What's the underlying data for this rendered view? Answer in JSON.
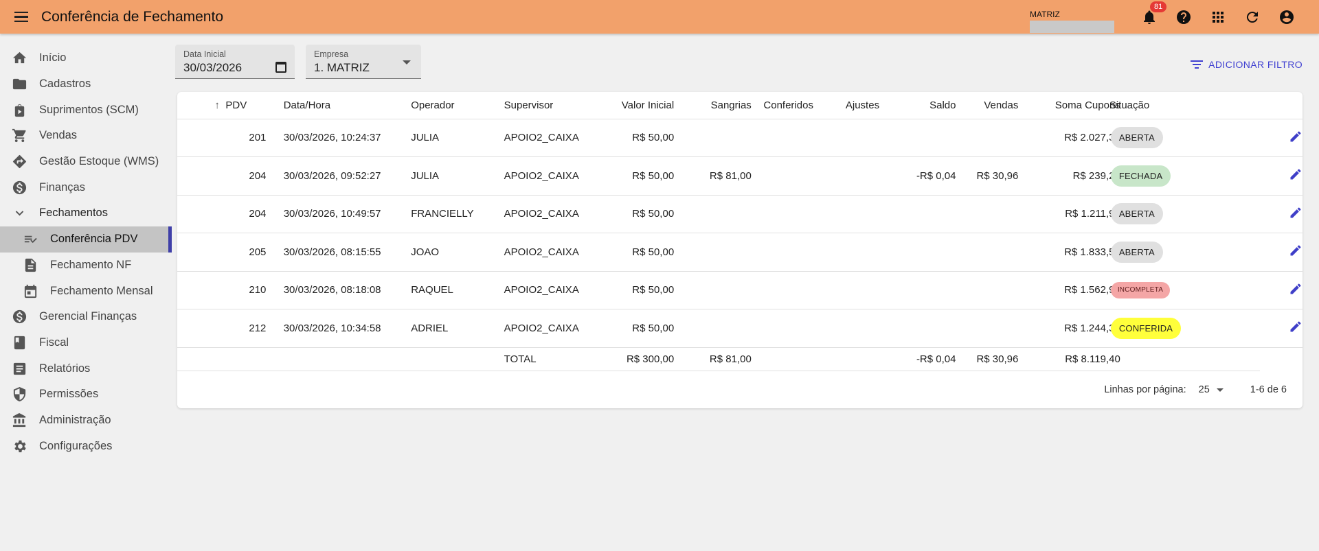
{
  "header": {
    "title": "Conferência de Fechamento",
    "company_label": "MATRIZ",
    "notification_count": "81"
  },
  "sidebar": {
    "items": [
      {
        "label": "Início",
        "icon": "home-icon"
      },
      {
        "label": "Cadastros",
        "icon": "folder-icon"
      },
      {
        "label": "Suprimentos (SCM)",
        "icon": "supplies-icon"
      },
      {
        "label": "Vendas",
        "icon": "cart-icon"
      },
      {
        "label": "Gestão Estoque (WMS)",
        "icon": "directions-icon"
      },
      {
        "label": "Finanças",
        "icon": "dollar-icon"
      },
      {
        "label": "Fechamentos",
        "icon": "chevron-down-icon"
      },
      {
        "label": "Conferência PDV",
        "icon": "checklist-icon"
      },
      {
        "label": "Fechamento NF",
        "icon": "document-icon"
      },
      {
        "label": "Fechamento Mensal",
        "icon": "calendar-icon"
      },
      {
        "label": "Gerencial Finanças",
        "icon": "dollar-icon"
      },
      {
        "label": "Fiscal",
        "icon": "book-icon"
      },
      {
        "label": "Relatórios",
        "icon": "report-icon"
      },
      {
        "label": "Permissões",
        "icon": "shield-icon"
      },
      {
        "label": "Administração",
        "icon": "bank-icon"
      },
      {
        "label": "Configurações",
        "icon": "gear-icon"
      }
    ]
  },
  "filters": {
    "date_label": "Data Inicial",
    "date_value": "30/03/2026",
    "company_label": "Empresa",
    "company_value": "1. MATRIZ",
    "add_filter_label": "ADICIONAR FILTRO"
  },
  "table": {
    "columns": [
      "PDV",
      "Data/Hora",
      "Operador",
      "Supervisor",
      "Valor Inicial",
      "Sangrias",
      "Conferidos",
      "Ajustes",
      "Saldo",
      "Vendas",
      "Soma Cupons",
      "Situação"
    ],
    "rows": [
      {
        "pdv": "201",
        "datahora": "30/03/2026, 10:24:37",
        "operador": "JULIA",
        "supervisor": "APOIO2_CAIXA",
        "valor_inicial": "R$ 50,00",
        "sangrias": "",
        "conferidos": "",
        "ajustes": "",
        "saldo": "",
        "vendas": "",
        "soma_cupons": "R$ 2.027,37",
        "situacao": "ABERTA"
      },
      {
        "pdv": "204",
        "datahora": "30/03/2026, 09:52:27",
        "operador": "JULIA",
        "supervisor": "APOIO2_CAIXA",
        "valor_inicial": "R$ 50,00",
        "sangrias": "R$ 81,00",
        "conferidos": "",
        "ajustes": "",
        "saldo": "-R$ 0,04",
        "vendas": "R$ 30,96",
        "soma_cupons": "R$ 239,29",
        "situacao": "FECHADA"
      },
      {
        "pdv": "204",
        "datahora": "30/03/2026, 10:49:57",
        "operador": "FRANCIELLY",
        "supervisor": "APOIO2_CAIXA",
        "valor_inicial": "R$ 50,00",
        "sangrias": "",
        "conferidos": "",
        "ajustes": "",
        "saldo": "",
        "vendas": "",
        "soma_cupons": "R$ 1.211,91",
        "situacao": "ABERTA"
      },
      {
        "pdv": "205",
        "datahora": "30/03/2026, 08:15:55",
        "operador": "JOAO",
        "supervisor": "APOIO2_CAIXA",
        "valor_inicial": "R$ 50,00",
        "sangrias": "",
        "conferidos": "",
        "ajustes": "",
        "saldo": "",
        "vendas": "",
        "soma_cupons": "R$ 1.833,55",
        "situacao": "ABERTA"
      },
      {
        "pdv": "210",
        "datahora": "30/03/2026, 08:18:08",
        "operador": "RAQUEL",
        "supervisor": "APOIO2_CAIXA",
        "valor_inicial": "R$ 50,00",
        "sangrias": "",
        "conferidos": "",
        "ajustes": "",
        "saldo": "",
        "vendas": "",
        "soma_cupons": "R$ 1.562,98",
        "situacao": "INCOMPLETA"
      },
      {
        "pdv": "212",
        "datahora": "30/03/2026, 10:34:58",
        "operador": "ADRIEL",
        "supervisor": "APOIO2_CAIXA",
        "valor_inicial": "R$ 50,00",
        "sangrias": "",
        "conferidos": "",
        "ajustes": "",
        "saldo": "",
        "vendas": "",
        "soma_cupons": "R$ 1.244,30",
        "situacao": "CONFERIDA"
      }
    ],
    "total": {
      "label": "TOTAL",
      "valor_inicial": "R$ 300,00",
      "sangrias": "R$ 81,00",
      "saldo": "-R$ 0,04",
      "vendas": "R$ 30,96",
      "soma_cupons": "R$ 8.119,40"
    }
  },
  "status_colors": {
    "ABERTA": {
      "bg": "#e0e0e0",
      "fg": "#222222"
    },
    "FECHADA": {
      "bg": "#c8e6c9",
      "fg": "#222222"
    },
    "INCOMPLETA": {
      "bg": "#f4a6a6",
      "fg": "#5a1a1a"
    },
    "CONFERIDA": {
      "bg": "#ffff3b",
      "fg": "#222222"
    }
  },
  "pagination": {
    "rows_per_page_label": "Linhas por página:",
    "rows_per_page_value": "25",
    "range": "1-6 de 6"
  }
}
